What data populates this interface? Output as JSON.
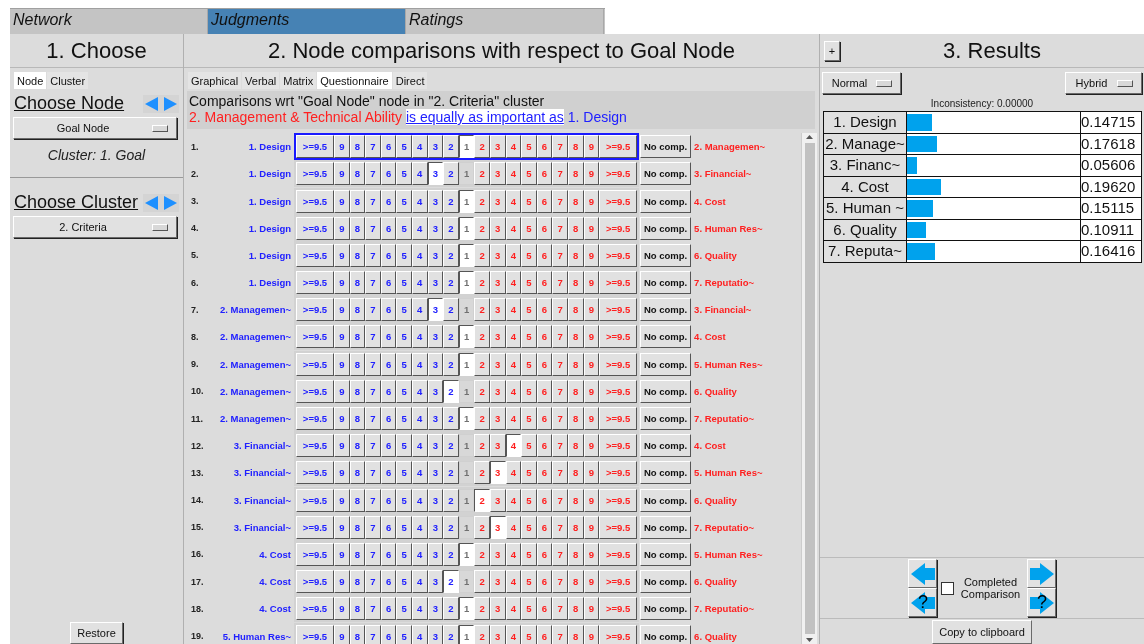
{
  "menu_tabs": [
    {
      "label": "Network",
      "selected": false
    },
    {
      "label": "Judgments",
      "selected": true
    },
    {
      "label": "Ratings",
      "selected": false
    }
  ],
  "choose": {
    "title": "1. Choose",
    "tabs": [
      {
        "label": "Node",
        "selected": true
      },
      {
        "label": "Cluster",
        "selected": false
      }
    ],
    "node_heading": "Choose Node",
    "node_dropdown": "Goal Node",
    "cluster_note": "Cluster: 1. Goal",
    "cluster_heading": "Choose Cluster",
    "cluster_dropdown": "2. Criteria",
    "restore_button": "Restore"
  },
  "comparisons": {
    "title": "2. Node comparisons with respect to Goal Node",
    "tabs": [
      {
        "label": "Graphical",
        "selected": false
      },
      {
        "label": "Verbal",
        "selected": false
      },
      {
        "label": "Matrix",
        "selected": false
      },
      {
        "label": "Questionnaire",
        "selected": true
      },
      {
        "label": "Direct",
        "selected": false
      }
    ],
    "context": "Comparisons wrt \"Goal Node\" node in \"2. Criteria\" cluster",
    "verdict": {
      "left": "2. Management & Technical Ability",
      "relation": "is equally as important as",
      "right": "1. Design"
    },
    "rows": [
      {
        "number": "1.",
        "left": "1. Design",
        "right": "2. Managemen~",
        "focused": true,
        "no_comp": "No comp.",
        "scale": [
          {
            "label": ">=9.5",
            "selected": false
          },
          {
            "label": "9",
            "selected": false
          },
          {
            "label": "8",
            "selected": false
          },
          {
            "label": "7",
            "selected": false
          },
          {
            "label": "6",
            "selected": false
          },
          {
            "label": "5",
            "selected": false
          },
          {
            "label": "4",
            "selected": false
          },
          {
            "label": "3",
            "selected": false
          },
          {
            "label": "2",
            "selected": false
          },
          {
            "label": "1",
            "selected": true
          },
          {
            "label": "2",
            "selected": false
          },
          {
            "label": "3",
            "selected": false
          },
          {
            "label": "4",
            "selected": false
          },
          {
            "label": "5",
            "selected": false
          },
          {
            "label": "6",
            "selected": false
          },
          {
            "label": "7",
            "selected": false
          },
          {
            "label": "8",
            "selected": false
          },
          {
            "label": "9",
            "selected": false
          },
          {
            "label": ">=9.5",
            "selected": false
          }
        ]
      },
      {
        "number": "2.",
        "left": "1. Design",
        "right": "3. Financial~",
        "focused": false,
        "no_comp": "No comp.",
        "scale": [
          {
            "label": ">=9.5",
            "selected": false
          },
          {
            "label": "9",
            "selected": false
          },
          {
            "label": "8",
            "selected": false
          },
          {
            "label": "7",
            "selected": false
          },
          {
            "label": "6",
            "selected": false
          },
          {
            "label": "5",
            "selected": false
          },
          {
            "label": "4",
            "selected": false
          },
          {
            "label": "3",
            "selected": true
          },
          {
            "label": "2",
            "selected": false
          },
          {
            "label": "1",
            "selected": false
          },
          {
            "label": "2",
            "selected": false
          },
          {
            "label": "3",
            "selected": false
          },
          {
            "label": "4",
            "selected": false
          },
          {
            "label": "5",
            "selected": false
          },
          {
            "label": "6",
            "selected": false
          },
          {
            "label": "7",
            "selected": false
          },
          {
            "label": "8",
            "selected": false
          },
          {
            "label": "9",
            "selected": false
          },
          {
            "label": ">=9.5",
            "selected": false
          }
        ]
      },
      {
        "number": "3.",
        "left": "1. Design",
        "right": "4. Cost",
        "focused": false,
        "no_comp": "No comp.",
        "scale": [
          {
            "label": ">=9.5",
            "selected": false
          },
          {
            "label": "9",
            "selected": false
          },
          {
            "label": "8",
            "selected": false
          },
          {
            "label": "7",
            "selected": false
          },
          {
            "label": "6",
            "selected": false
          },
          {
            "label": "5",
            "selected": false
          },
          {
            "label": "4",
            "selected": false
          },
          {
            "label": "3",
            "selected": false
          },
          {
            "label": "2",
            "selected": false
          },
          {
            "label": "1",
            "selected": true
          },
          {
            "label": "2",
            "selected": false
          },
          {
            "label": "3",
            "selected": false
          },
          {
            "label": "4",
            "selected": false
          },
          {
            "label": "5",
            "selected": false
          },
          {
            "label": "6",
            "selected": false
          },
          {
            "label": "7",
            "selected": false
          },
          {
            "label": "8",
            "selected": false
          },
          {
            "label": "9",
            "selected": false
          },
          {
            "label": ">=9.5",
            "selected": false
          }
        ]
      },
      {
        "number": "4.",
        "left": "1. Design",
        "right": "5. Human Res~",
        "focused": false,
        "no_comp": "No comp.",
        "scale": [
          {
            "label": ">=9.5",
            "selected": false
          },
          {
            "label": "9",
            "selected": false
          },
          {
            "label": "8",
            "selected": false
          },
          {
            "label": "7",
            "selected": false
          },
          {
            "label": "6",
            "selected": false
          },
          {
            "label": "5",
            "selected": false
          },
          {
            "label": "4",
            "selected": false
          },
          {
            "label": "3",
            "selected": false
          },
          {
            "label": "2",
            "selected": false
          },
          {
            "label": "1",
            "selected": true
          },
          {
            "label": "2",
            "selected": false
          },
          {
            "label": "3",
            "selected": false
          },
          {
            "label": "4",
            "selected": false
          },
          {
            "label": "5",
            "selected": false
          },
          {
            "label": "6",
            "selected": false
          },
          {
            "label": "7",
            "selected": false
          },
          {
            "label": "8",
            "selected": false
          },
          {
            "label": "9",
            "selected": false
          },
          {
            "label": ">=9.5",
            "selected": false
          }
        ]
      },
      {
        "number": "5.",
        "left": "1. Design",
        "right": "6. Quality",
        "focused": false,
        "no_comp": "No comp.",
        "scale": [
          {
            "label": ">=9.5",
            "selected": false
          },
          {
            "label": "9",
            "selected": false
          },
          {
            "label": "8",
            "selected": false
          },
          {
            "label": "7",
            "selected": false
          },
          {
            "label": "6",
            "selected": false
          },
          {
            "label": "5",
            "selected": false
          },
          {
            "label": "4",
            "selected": false
          },
          {
            "label": "3",
            "selected": false
          },
          {
            "label": "2",
            "selected": false
          },
          {
            "label": "1",
            "selected": true
          },
          {
            "label": "2",
            "selected": false
          },
          {
            "label": "3",
            "selected": false
          },
          {
            "label": "4",
            "selected": false
          },
          {
            "label": "5",
            "selected": false
          },
          {
            "label": "6",
            "selected": false
          },
          {
            "label": "7",
            "selected": false
          },
          {
            "label": "8",
            "selected": false
          },
          {
            "label": "9",
            "selected": false
          },
          {
            "label": ">=9.5",
            "selected": false
          }
        ]
      },
      {
        "number": "6.",
        "left": "1. Design",
        "right": "7. Reputatio~",
        "focused": false,
        "no_comp": "No comp.",
        "scale": [
          {
            "label": ">=9.5",
            "selected": false
          },
          {
            "label": "9",
            "selected": false
          },
          {
            "label": "8",
            "selected": false
          },
          {
            "label": "7",
            "selected": false
          },
          {
            "label": "6",
            "selected": false
          },
          {
            "label": "5",
            "selected": false
          },
          {
            "label": "4",
            "selected": false
          },
          {
            "label": "3",
            "selected": false
          },
          {
            "label": "2",
            "selected": false
          },
          {
            "label": "1",
            "selected": true
          },
          {
            "label": "2",
            "selected": false
          },
          {
            "label": "3",
            "selected": false
          },
          {
            "label": "4",
            "selected": false
          },
          {
            "label": "5",
            "selected": false
          },
          {
            "label": "6",
            "selected": false
          },
          {
            "label": "7",
            "selected": false
          },
          {
            "label": "8",
            "selected": false
          },
          {
            "label": "9",
            "selected": false
          },
          {
            "label": ">=9.5",
            "selected": false
          }
        ]
      },
      {
        "number": "7.",
        "left": "2. Managemen~",
        "right": "3. Financial~",
        "focused": false,
        "no_comp": "No comp.",
        "scale": [
          {
            "label": ">=9.5",
            "selected": false
          },
          {
            "label": "9",
            "selected": false
          },
          {
            "label": "8",
            "selected": false
          },
          {
            "label": "7",
            "selected": false
          },
          {
            "label": "6",
            "selected": false
          },
          {
            "label": "5",
            "selected": false
          },
          {
            "label": "4",
            "selected": false
          },
          {
            "label": "3",
            "selected": true
          },
          {
            "label": "2",
            "selected": false
          },
          {
            "label": "1",
            "selected": false
          },
          {
            "label": "2",
            "selected": false
          },
          {
            "label": "3",
            "selected": false
          },
          {
            "label": "4",
            "selected": false
          },
          {
            "label": "5",
            "selected": false
          },
          {
            "label": "6",
            "selected": false
          },
          {
            "label": "7",
            "selected": false
          },
          {
            "label": "8",
            "selected": false
          },
          {
            "label": "9",
            "selected": false
          },
          {
            "label": ">=9.5",
            "selected": false
          }
        ]
      },
      {
        "number": "8.",
        "left": "2. Managemen~",
        "right": "4. Cost",
        "focused": false,
        "no_comp": "No comp.",
        "scale": [
          {
            "label": ">=9.5",
            "selected": false
          },
          {
            "label": "9",
            "selected": false
          },
          {
            "label": "8",
            "selected": false
          },
          {
            "label": "7",
            "selected": false
          },
          {
            "label": "6",
            "selected": false
          },
          {
            "label": "5",
            "selected": false
          },
          {
            "label": "4",
            "selected": false
          },
          {
            "label": "3",
            "selected": false
          },
          {
            "label": "2",
            "selected": false
          },
          {
            "label": "1",
            "selected": true
          },
          {
            "label": "2",
            "selected": false
          },
          {
            "label": "3",
            "selected": false
          },
          {
            "label": "4",
            "selected": false
          },
          {
            "label": "5",
            "selected": false
          },
          {
            "label": "6",
            "selected": false
          },
          {
            "label": "7",
            "selected": false
          },
          {
            "label": "8",
            "selected": false
          },
          {
            "label": "9",
            "selected": false
          },
          {
            "label": ">=9.5",
            "selected": false
          }
        ]
      },
      {
        "number": "9.",
        "left": "2. Managemen~",
        "right": "5. Human Res~",
        "focused": false,
        "no_comp": "No comp.",
        "scale": [
          {
            "label": ">=9.5",
            "selected": false
          },
          {
            "label": "9",
            "selected": false
          },
          {
            "label": "8",
            "selected": false
          },
          {
            "label": "7",
            "selected": false
          },
          {
            "label": "6",
            "selected": false
          },
          {
            "label": "5",
            "selected": false
          },
          {
            "label": "4",
            "selected": false
          },
          {
            "label": "3",
            "selected": false
          },
          {
            "label": "2",
            "selected": false
          },
          {
            "label": "1",
            "selected": true
          },
          {
            "label": "2",
            "selected": false
          },
          {
            "label": "3",
            "selected": false
          },
          {
            "label": "4",
            "selected": false
          },
          {
            "label": "5",
            "selected": false
          },
          {
            "label": "6",
            "selected": false
          },
          {
            "label": "7",
            "selected": false
          },
          {
            "label": "8",
            "selected": false
          },
          {
            "label": "9",
            "selected": false
          },
          {
            "label": ">=9.5",
            "selected": false
          }
        ]
      },
      {
        "number": "10.",
        "left": "2. Managemen~",
        "right": "6. Quality",
        "focused": false,
        "no_comp": "No comp.",
        "scale": [
          {
            "label": ">=9.5",
            "selected": false
          },
          {
            "label": "9",
            "selected": false
          },
          {
            "label": "8",
            "selected": false
          },
          {
            "label": "7",
            "selected": false
          },
          {
            "label": "6",
            "selected": false
          },
          {
            "label": "5",
            "selected": false
          },
          {
            "label": "4",
            "selected": false
          },
          {
            "label": "3",
            "selected": false
          },
          {
            "label": "2",
            "selected": true
          },
          {
            "label": "1",
            "selected": false
          },
          {
            "label": "2",
            "selected": false
          },
          {
            "label": "3",
            "selected": false
          },
          {
            "label": "4",
            "selected": false
          },
          {
            "label": "5",
            "selected": false
          },
          {
            "label": "6",
            "selected": false
          },
          {
            "label": "7",
            "selected": false
          },
          {
            "label": "8",
            "selected": false
          },
          {
            "label": "9",
            "selected": false
          },
          {
            "label": ">=9.5",
            "selected": false
          }
        ]
      },
      {
        "number": "11.",
        "left": "2. Managemen~",
        "right": "7. Reputatio~",
        "focused": false,
        "no_comp": "No comp.",
        "scale": [
          {
            "label": ">=9.5",
            "selected": false
          },
          {
            "label": "9",
            "selected": false
          },
          {
            "label": "8",
            "selected": false
          },
          {
            "label": "7",
            "selected": false
          },
          {
            "label": "6",
            "selected": false
          },
          {
            "label": "5",
            "selected": false
          },
          {
            "label": "4",
            "selected": false
          },
          {
            "label": "3",
            "selected": false
          },
          {
            "label": "2",
            "selected": false
          },
          {
            "label": "1",
            "selected": true
          },
          {
            "label": "2",
            "selected": false
          },
          {
            "label": "3",
            "selected": false
          },
          {
            "label": "4",
            "selected": false
          },
          {
            "label": "5",
            "selected": false
          },
          {
            "label": "6",
            "selected": false
          },
          {
            "label": "7",
            "selected": false
          },
          {
            "label": "8",
            "selected": false
          },
          {
            "label": "9",
            "selected": false
          },
          {
            "label": ">=9.5",
            "selected": false
          }
        ]
      },
      {
        "number": "12.",
        "left": "3. Financial~",
        "right": "4. Cost",
        "focused": false,
        "no_comp": "No comp.",
        "scale": [
          {
            "label": ">=9.5",
            "selected": false
          },
          {
            "label": "9",
            "selected": false
          },
          {
            "label": "8",
            "selected": false
          },
          {
            "label": "7",
            "selected": false
          },
          {
            "label": "6",
            "selected": false
          },
          {
            "label": "5",
            "selected": false
          },
          {
            "label": "4",
            "selected": false
          },
          {
            "label": "3",
            "selected": false
          },
          {
            "label": "2",
            "selected": false
          },
          {
            "label": "1",
            "selected": false
          },
          {
            "label": "2",
            "selected": false
          },
          {
            "label": "3",
            "selected": false
          },
          {
            "label": "4",
            "selected": true
          },
          {
            "label": "5",
            "selected": false
          },
          {
            "label": "6",
            "selected": false
          },
          {
            "label": "7",
            "selected": false
          },
          {
            "label": "8",
            "selected": false
          },
          {
            "label": "9",
            "selected": false
          },
          {
            "label": ">=9.5",
            "selected": false
          }
        ]
      },
      {
        "number": "13.",
        "left": "3. Financial~",
        "right": "5. Human Res~",
        "focused": false,
        "no_comp": "No comp.",
        "scale": [
          {
            "label": ">=9.5",
            "selected": false
          },
          {
            "label": "9",
            "selected": false
          },
          {
            "label": "8",
            "selected": false
          },
          {
            "label": "7",
            "selected": false
          },
          {
            "label": "6",
            "selected": false
          },
          {
            "label": "5",
            "selected": false
          },
          {
            "label": "4",
            "selected": false
          },
          {
            "label": "3",
            "selected": false
          },
          {
            "label": "2",
            "selected": false
          },
          {
            "label": "1",
            "selected": false
          },
          {
            "label": "2",
            "selected": false
          },
          {
            "label": "3",
            "selected": true
          },
          {
            "label": "4",
            "selected": false
          },
          {
            "label": "5",
            "selected": false
          },
          {
            "label": "6",
            "selected": false
          },
          {
            "label": "7",
            "selected": false
          },
          {
            "label": "8",
            "selected": false
          },
          {
            "label": "9",
            "selected": false
          },
          {
            "label": ">=9.5",
            "selected": false
          }
        ]
      },
      {
        "number": "14.",
        "left": "3. Financial~",
        "right": "6. Quality",
        "focused": false,
        "no_comp": "No comp.",
        "scale": [
          {
            "label": ">=9.5",
            "selected": false
          },
          {
            "label": "9",
            "selected": false
          },
          {
            "label": "8",
            "selected": false
          },
          {
            "label": "7",
            "selected": false
          },
          {
            "label": "6",
            "selected": false
          },
          {
            "label": "5",
            "selected": false
          },
          {
            "label": "4",
            "selected": false
          },
          {
            "label": "3",
            "selected": false
          },
          {
            "label": "2",
            "selected": false
          },
          {
            "label": "1",
            "selected": false
          },
          {
            "label": "2",
            "selected": true
          },
          {
            "label": "3",
            "selected": false
          },
          {
            "label": "4",
            "selected": false
          },
          {
            "label": "5",
            "selected": false
          },
          {
            "label": "6",
            "selected": false
          },
          {
            "label": "7",
            "selected": false
          },
          {
            "label": "8",
            "selected": false
          },
          {
            "label": "9",
            "selected": false
          },
          {
            "label": ">=9.5",
            "selected": false
          }
        ]
      },
      {
        "number": "15.",
        "left": "3. Financial~",
        "right": "7. Reputatio~",
        "focused": false,
        "no_comp": "No comp.",
        "scale": [
          {
            "label": ">=9.5",
            "selected": false
          },
          {
            "label": "9",
            "selected": false
          },
          {
            "label": "8",
            "selected": false
          },
          {
            "label": "7",
            "selected": false
          },
          {
            "label": "6",
            "selected": false
          },
          {
            "label": "5",
            "selected": false
          },
          {
            "label": "4",
            "selected": false
          },
          {
            "label": "3",
            "selected": false
          },
          {
            "label": "2",
            "selected": false
          },
          {
            "label": "1",
            "selected": false
          },
          {
            "label": "2",
            "selected": false
          },
          {
            "label": "3",
            "selected": true
          },
          {
            "label": "4",
            "selected": false
          },
          {
            "label": "5",
            "selected": false
          },
          {
            "label": "6",
            "selected": false
          },
          {
            "label": "7",
            "selected": false
          },
          {
            "label": "8",
            "selected": false
          },
          {
            "label": "9",
            "selected": false
          },
          {
            "label": ">=9.5",
            "selected": false
          }
        ]
      },
      {
        "number": "16.",
        "left": "4. Cost",
        "right": "5. Human Res~",
        "focused": false,
        "no_comp": "No comp.",
        "scale": [
          {
            "label": ">=9.5",
            "selected": false
          },
          {
            "label": "9",
            "selected": false
          },
          {
            "label": "8",
            "selected": false
          },
          {
            "label": "7",
            "selected": false
          },
          {
            "label": "6",
            "selected": false
          },
          {
            "label": "5",
            "selected": false
          },
          {
            "label": "4",
            "selected": false
          },
          {
            "label": "3",
            "selected": false
          },
          {
            "label": "2",
            "selected": false
          },
          {
            "label": "1",
            "selected": true
          },
          {
            "label": "2",
            "selected": false
          },
          {
            "label": "3",
            "selected": false
          },
          {
            "label": "4",
            "selected": false
          },
          {
            "label": "5",
            "selected": false
          },
          {
            "label": "6",
            "selected": false
          },
          {
            "label": "7",
            "selected": false
          },
          {
            "label": "8",
            "selected": false
          },
          {
            "label": "9",
            "selected": false
          },
          {
            "label": ">=9.5",
            "selected": false
          }
        ]
      },
      {
        "number": "17.",
        "left": "4. Cost",
        "right": "6. Quality",
        "focused": false,
        "no_comp": "No comp.",
        "scale": [
          {
            "label": ">=9.5",
            "selected": false
          },
          {
            "label": "9",
            "selected": false
          },
          {
            "label": "8",
            "selected": false
          },
          {
            "label": "7",
            "selected": false
          },
          {
            "label": "6",
            "selected": false
          },
          {
            "label": "5",
            "selected": false
          },
          {
            "label": "4",
            "selected": false
          },
          {
            "label": "3",
            "selected": false
          },
          {
            "label": "2",
            "selected": true
          },
          {
            "label": "1",
            "selected": false
          },
          {
            "label": "2",
            "selected": false
          },
          {
            "label": "3",
            "selected": false
          },
          {
            "label": "4",
            "selected": false
          },
          {
            "label": "5",
            "selected": false
          },
          {
            "label": "6",
            "selected": false
          },
          {
            "label": "7",
            "selected": false
          },
          {
            "label": "8",
            "selected": false
          },
          {
            "label": "9",
            "selected": false
          },
          {
            "label": ">=9.5",
            "selected": false
          }
        ]
      },
      {
        "number": "18.",
        "left": "4. Cost",
        "right": "7. Reputatio~",
        "focused": false,
        "no_comp": "No comp.",
        "scale": [
          {
            "label": ">=9.5",
            "selected": false
          },
          {
            "label": "9",
            "selected": false
          },
          {
            "label": "8",
            "selected": false
          },
          {
            "label": "7",
            "selected": false
          },
          {
            "label": "6",
            "selected": false
          },
          {
            "label": "5",
            "selected": false
          },
          {
            "label": "4",
            "selected": false
          },
          {
            "label": "3",
            "selected": false
          },
          {
            "label": "2",
            "selected": false
          },
          {
            "label": "1",
            "selected": true
          },
          {
            "label": "2",
            "selected": false
          },
          {
            "label": "3",
            "selected": false
          },
          {
            "label": "4",
            "selected": false
          },
          {
            "label": "5",
            "selected": false
          },
          {
            "label": "6",
            "selected": false
          },
          {
            "label": "7",
            "selected": false
          },
          {
            "label": "8",
            "selected": false
          },
          {
            "label": "9",
            "selected": false
          },
          {
            "label": ">=9.5",
            "selected": false
          }
        ]
      },
      {
        "number": "19.",
        "left": "5. Human Res~",
        "right": "6. Quality",
        "focused": false,
        "no_comp": "No comp.",
        "scale": [
          {
            "label": ">=9.5",
            "selected": false
          },
          {
            "label": "9",
            "selected": false
          },
          {
            "label": "8",
            "selected": false
          },
          {
            "label": "7",
            "selected": false
          },
          {
            "label": "6",
            "selected": false
          },
          {
            "label": "5",
            "selected": false
          },
          {
            "label": "4",
            "selected": false
          },
          {
            "label": "3",
            "selected": false
          },
          {
            "label": "2",
            "selected": false
          },
          {
            "label": "1",
            "selected": true
          },
          {
            "label": "2",
            "selected": false
          },
          {
            "label": "3",
            "selected": false
          },
          {
            "label": "4",
            "selected": false
          },
          {
            "label": "5",
            "selected": false
          },
          {
            "label": "6",
            "selected": false
          },
          {
            "label": "7",
            "selected": false
          },
          {
            "label": "8",
            "selected": false
          },
          {
            "label": "9",
            "selected": false
          },
          {
            "label": ">=9.5",
            "selected": false
          }
        ]
      }
    ]
  },
  "results": {
    "expand_button": "+",
    "title": "3. Results",
    "mode_dropdown": "Normal",
    "type_dropdown": "Hybrid",
    "inconsistency": "Inconsistency: 0.00000",
    "priorities": [
      {
        "name": "1. Design",
        "level": 0.14715,
        "value": "0.14715"
      },
      {
        "name": "2. Manage~",
        "level": 0.17618,
        "value": "0.17618"
      },
      {
        "name": "3. Financ~",
        "level": 0.05606,
        "value": "0.05606"
      },
      {
        "name": "4. Cost",
        "level": 0.1962,
        "value": "0.19620"
      },
      {
        "name": "5. Human ~",
        "level": 0.15115,
        "value": "0.15115"
      },
      {
        "name": "6. Quality",
        "level": 0.10911,
        "value": "0.10911"
      },
      {
        "name": "7. Reputa~",
        "level": 0.16416,
        "value": "0.16416"
      }
    ],
    "previous_unanswered_mark": "?",
    "next_unanswered_mark": "?",
    "completed": {
      "label": "Completed Comparison",
      "checked": false
    },
    "copy_button": "Copy to clipboard"
  }
}
